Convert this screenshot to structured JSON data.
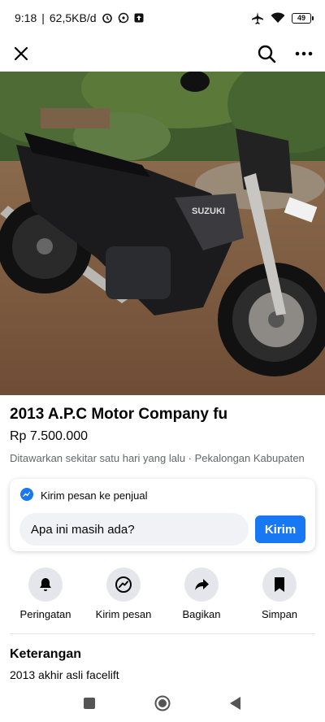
{
  "status_bar": {
    "time": "9:18",
    "network_speed": "62,5KB/d",
    "battery": "49",
    "icons": [
      "alarm-icon",
      "whatsapp-icon",
      "upload-icon",
      "airplane-icon",
      "wifi-icon",
      "battery-icon"
    ]
  },
  "top_bar": {
    "icons": [
      "close-icon",
      "search-icon",
      "more-icon"
    ]
  },
  "gallery": {
    "image_count": 5,
    "active_index": 3,
    "badge_text": "SUZUKI"
  },
  "listing": {
    "title": "2013 A.P.C Motor Company fu",
    "price": "Rp 7.500.000",
    "meta": "Ditawarkan sekitar satu hari yang lalu · Pekalongan Kabupaten"
  },
  "message": {
    "header": "Kirim pesan ke penjual",
    "input_value": "Apa ini masih ada?",
    "send_label": "Kirim"
  },
  "actions": [
    {
      "label": "Peringatan",
      "icon": "bell-icon"
    },
    {
      "label": "Kirim pesan",
      "icon": "messenger-icon"
    },
    {
      "label": "Bagikan",
      "icon": "share-icon"
    },
    {
      "label": "Simpan",
      "icon": "bookmark-icon"
    }
  ],
  "description": {
    "heading": "Keterangan",
    "text": "2013 akhir asli facelift"
  },
  "nav": {
    "icons": [
      "recents-icon",
      "home-icon",
      "back-icon"
    ]
  },
  "colors": {
    "accent": "#1877f2",
    "secondary_text": "#65676b",
    "chip_bg": "#e4e6eb"
  }
}
